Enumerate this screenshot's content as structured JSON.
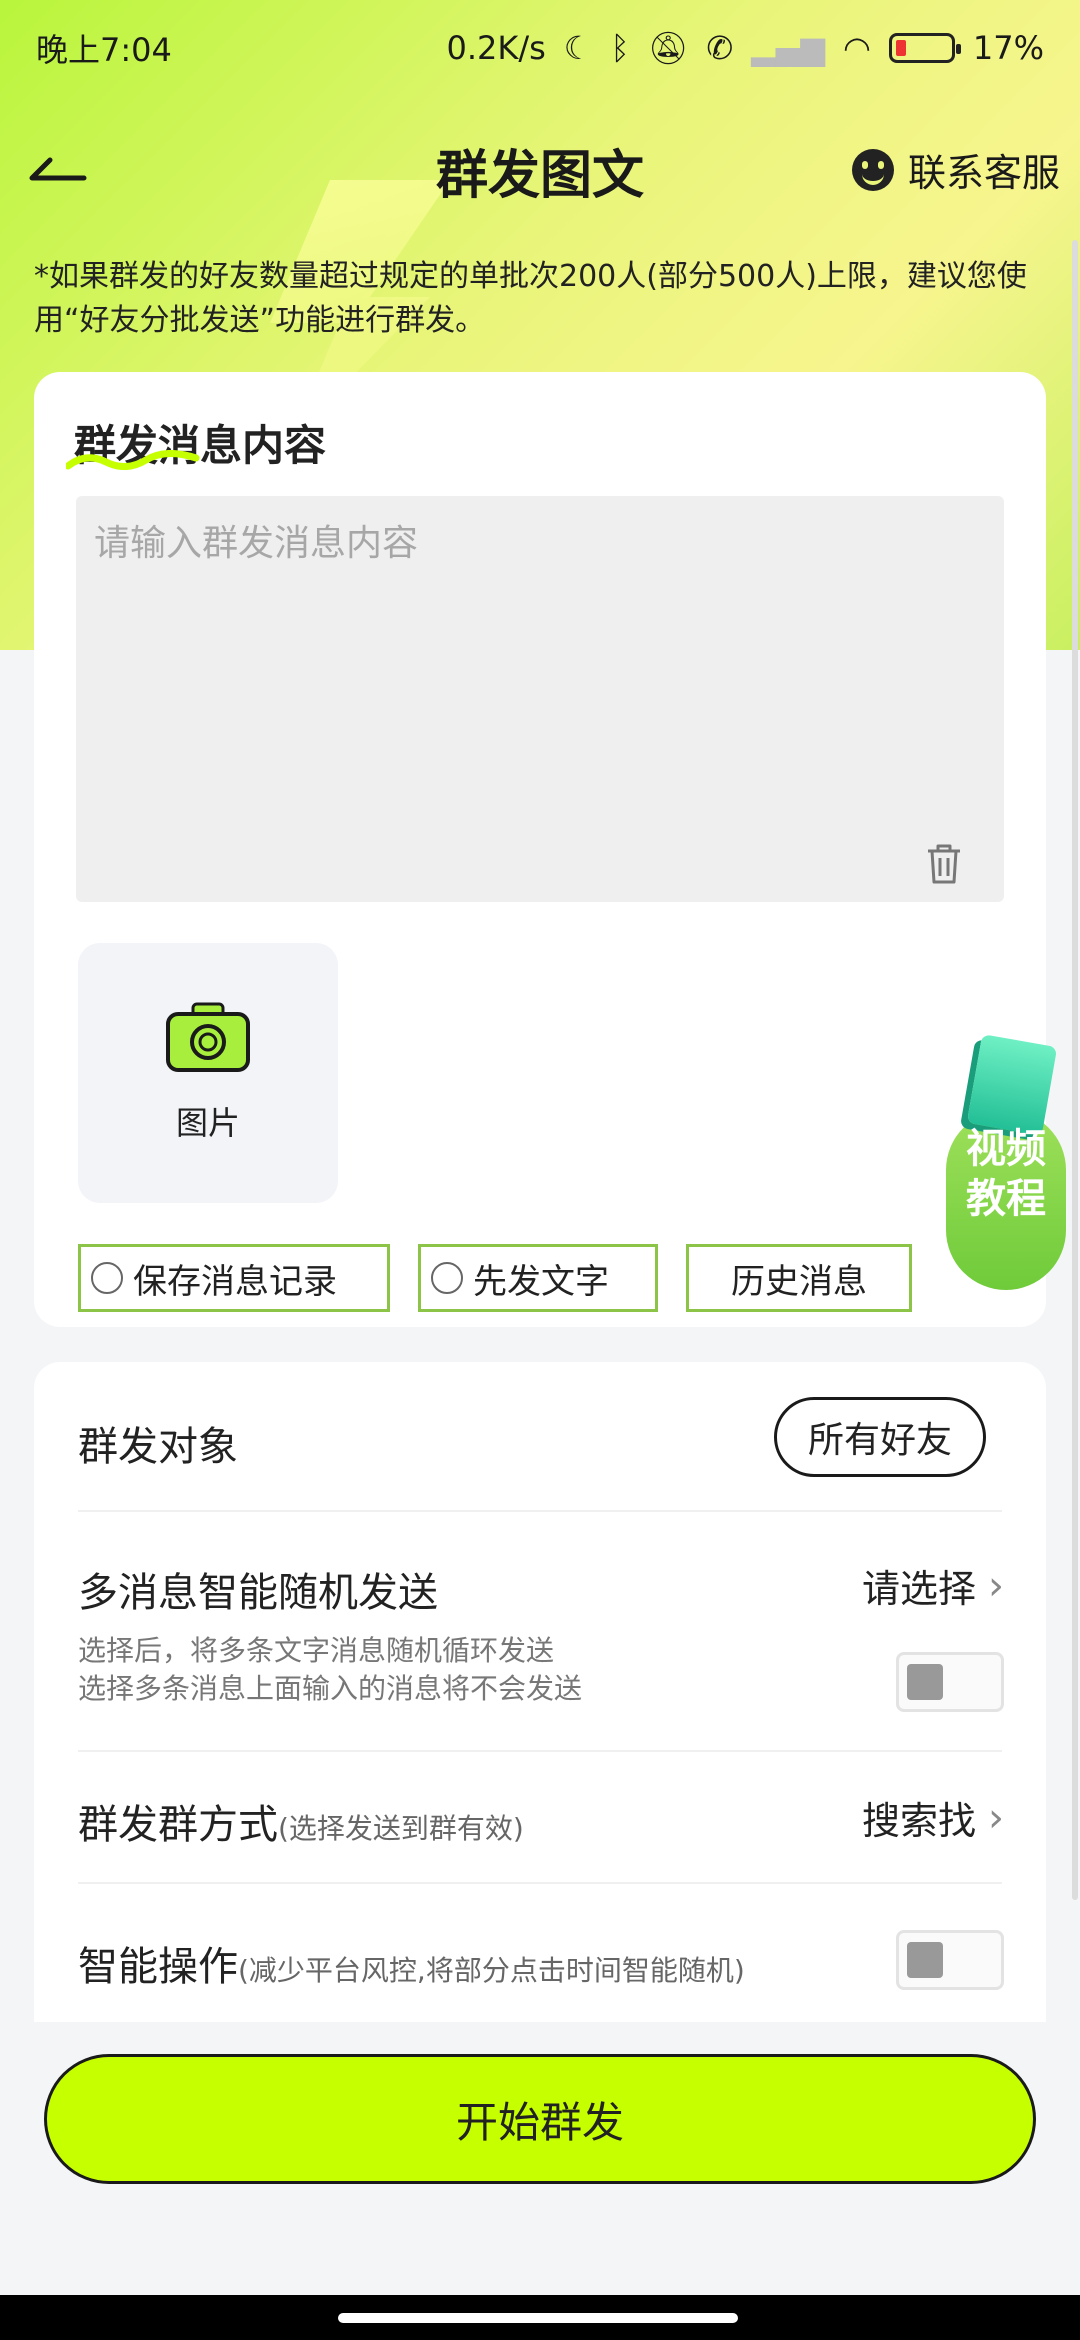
{
  "status_bar": {
    "time": "晚上7:04",
    "net_speed": "0.2K/s",
    "battery": "17%"
  },
  "header": {
    "title": "群发图文",
    "service_label": "联系客服"
  },
  "notice": "*如果群发的好友数量超过规定的单批次200人(部分500人)上限，建议您使用“好友分批发送”功能进行群发。",
  "message_card": {
    "section_title": "群发消息内容",
    "input_placeholder": "请输入群发消息内容",
    "photo_label": "图片",
    "options": [
      "保存消息记录",
      "先发文字",
      "历史消息"
    ]
  },
  "video_tutorial": {
    "line1": "视频",
    "line2": "教程"
  },
  "settings": {
    "target": {
      "label": "群发对象",
      "value": "所有好友"
    },
    "random_send": {
      "label": "多消息智能随机发送",
      "value": "请选择",
      "desc_line1": "选择后，将多条文字消息随机循环发送",
      "desc_line2": "选择多条消息上面输入的消息将不会发送",
      "toggle_on": false
    },
    "group_method": {
      "label": "群发群方式",
      "hint": "(选择发送到群有效)",
      "value": "搜索找"
    },
    "smart_op": {
      "label": "智能操作",
      "hint": "(减少平台风控,将部分点击时间智能随机)",
      "toggle_on": false
    }
  },
  "start_button": "开始群发",
  "colors": {
    "accent": "#c6ff00",
    "option_border": "#8cc447"
  }
}
